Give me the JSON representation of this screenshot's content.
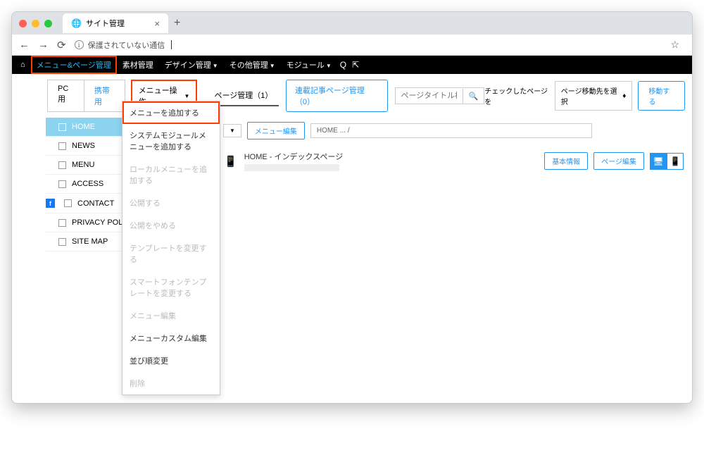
{
  "browser": {
    "tab_title": "サイト管理",
    "address_text": "保護されていない通信"
  },
  "nav": {
    "menu_page": "メニュー&ページ管理",
    "material": "素材管理",
    "design": "デザイン管理",
    "other": "その他管理",
    "module": "モジュール"
  },
  "toolbar": {
    "pc_tab": "PC用",
    "mobile_tab": "携帯用",
    "menu_ops": "メニュー操作",
    "page_mgmt": "ページ管理（1）",
    "serial_mgmt": "連載記事ページ管理（0）",
    "search_placeholder": "ページタイトル検索",
    "checked_label": "チェックしたページを",
    "select_dest": "ページ移動先を選択",
    "move_btn": "移動する"
  },
  "dropdown": {
    "add_menu": "メニューを追加する",
    "add_system_module": "システムモジュールメニューを追加する",
    "add_local": "ローカルメニューを追加する",
    "publish": "公開する",
    "unpublish": "公開をやめる",
    "change_template": "テンプレートを変更する",
    "change_sp_template": "スマートフォンテンプレートを変更する",
    "menu_edit": "メニュー編集",
    "menu_custom": "メニューカスタム編集",
    "reorder": "並び順変更",
    "delete": "削除"
  },
  "sidebar": {
    "items": [
      {
        "label": "HOME"
      },
      {
        "label": "NEWS"
      },
      {
        "label": "MENU"
      },
      {
        "label": "ACCESS"
      },
      {
        "label": "CONTACT"
      },
      {
        "label": "PRIVACY POLICY"
      },
      {
        "label": "SITE MAP"
      }
    ]
  },
  "content": {
    "menu_edit_btn": "メニュー編集",
    "breadcrumb": "HOME ... /",
    "page_title": "HOME - インデックスページ",
    "basic_info": "基本情報",
    "page_edit": "ページ編集"
  }
}
